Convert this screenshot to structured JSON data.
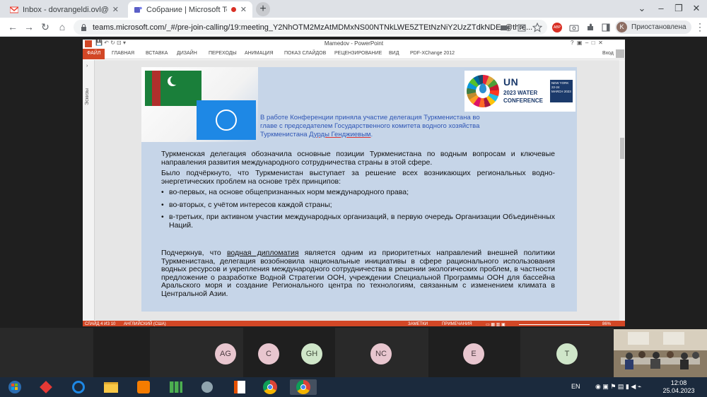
{
  "browser": {
    "tabs": [
      {
        "title": "Inbox - dovrangeldi.ovl@gmail.c"
      },
      {
        "title": "Собрание | Microsoft Teams"
      }
    ],
    "address": "teams.microsoft.com/_#/pre-join-calling/19:meeting_Y2NhOTM2MzAtMDMxNS00NTNkLWE5ZTEtNzNiY2UzZTdkNDEx@thre...",
    "profile_initial": "K",
    "profile_label": "Приостановлена",
    "abp_label": "ABP"
  },
  "powerpoint": {
    "doc_title": "Mamedov - PowerPoint",
    "signin": "Вход",
    "tabs": [
      "ФАЙЛ",
      "ГЛАВНАЯ",
      "ВСТАВКА",
      "ДИЗАЙН",
      "ПЕРЕХОДЫ",
      "АНИМАЦИЯ",
      "ПОКАЗ СЛАЙДОВ",
      "РЕЦЕНЗИРОВАНИЕ",
      "ВИД",
      "PDF-XChange 2012"
    ],
    "thumbs_label": "Эскизы",
    "status": {
      "slide": "СЛАЙД 4 ИЗ 10",
      "language": "АНГЛИЙСКИЙ (США)",
      "notes": "ЗАМЕТКИ",
      "comments": "ПРИМЕЧАНИЯ",
      "zoom": "86%"
    }
  },
  "slide": {
    "un_logo": {
      "title": "UN",
      "line1": "2023 WATER",
      "line2": "CONFERENCE",
      "date": "NEW YORK 22-24 MARCH 2023"
    },
    "caption_pre": "В работе Конференции приняла участие делегация Туркменистана во главе с председателем Государственного комитета водного хозяйства Туркменистана ",
    "caption_name": "Дурды Генджиевым",
    "caption_end": ".",
    "para1": "Туркменская делегация обозначила основные позиции Туркменистана по водным вопросам и ключевые направления развития международного сотрудничества страны в этой сфере.",
    "para2": "Было подчёркнуто, что Туркменистан выступает за решение всех возникающих региональных водно-энергетических проблем на основе трёх принципов:",
    "bullets": [
      "во-первых, на основе общепризнанных норм международного права;",
      "во-вторых, с учётом интересов каждой страны;",
      "в-третьих, при активном участии международных организаций, в первую очередь Организации Объединённых Наций."
    ],
    "para3_a": "Подчеркнув, что ",
    "para3_link": "водная дипломатия",
    "para3_b": " является одним из приоритетных направлений внешней политики Туркменистана, делегация возобновила национальные инициативы в сфере рационального использования водных ресурсов и укрепления международного сотрудничества в решении экологических проблем, в частности предложение о разработке Водной Стратегии ООН, учреждении Специальной Программы ООН для бассейна Аральского моря и создание Регионального центра по технологиям, связанным с изменением климата в Центральной Азии."
  },
  "participants": [
    {
      "initials": "AG",
      "color": "#e8c6cf"
    },
    {
      "initials": "C",
      "color": "#e8c6cf"
    },
    {
      "initials": "GH",
      "color": "#cfe6c9"
    },
    {
      "initials": "NC",
      "color": "#e8c6cf"
    },
    {
      "initials": "E",
      "color": "#e8c6cf"
    },
    {
      "initials": "T",
      "color": "#cfe6c9"
    }
  ],
  "taskbar": {
    "lang": "EN",
    "time": "12:08",
    "date": "25.04.2023"
  }
}
